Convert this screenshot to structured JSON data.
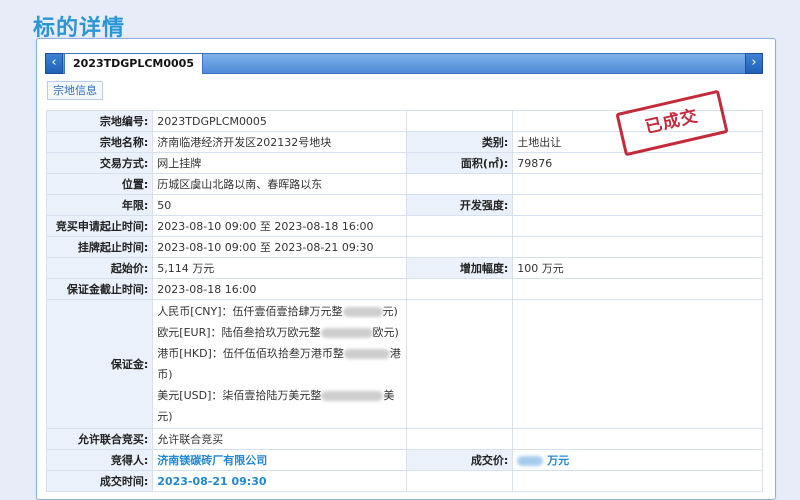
{
  "page": {
    "title": "标的详情"
  },
  "tabs": {
    "active_label": "2023TDGPLCM0005",
    "prev_icon": "‹",
    "next_icon": "›"
  },
  "subtab": {
    "label": "宗地信息"
  },
  "stamp": {
    "text": "已成交"
  },
  "fields": {
    "parcel_no": {
      "label": "宗地编号:",
      "value": "2023TDGPLCM0005"
    },
    "parcel_name": {
      "label": "宗地名称:",
      "value": "济南临港经济开发区202132号地块"
    },
    "category": {
      "label": "类别:",
      "value": "土地出让"
    },
    "trade_mode": {
      "label": "交易方式:",
      "value": "网上挂牌"
    },
    "area": {
      "label": "面积(㎡):",
      "value": "79876"
    },
    "location": {
      "label": "位置:",
      "value": "历城区虞山北路以南、春晖路以东"
    },
    "term": {
      "label": "年限:",
      "value": "50"
    },
    "intensity": {
      "label": "开发强度:",
      "value": ""
    },
    "apply_period": {
      "label": "竞买申请起止时间:",
      "value": "2023-08-10 09:00 至 2023-08-18 16:00"
    },
    "listing_period": {
      "label": "挂牌起止时间:",
      "value": "2023-08-10 09:00 至 2023-08-21 09:30"
    },
    "start_price": {
      "label": "起始价:",
      "value": "5,114 万元"
    },
    "increment": {
      "label": "增加幅度:",
      "value": "100 万元"
    },
    "deposit_deadline": {
      "label": "保证金截止时间:",
      "value": "2023-08-18 16:00"
    },
    "deposit": {
      "label": "保证金:",
      "lines": {
        "cny_a": "人民币[CNY]：伍仟壹佰壹拾肆万元整",
        "cny_b": "元)",
        "eur_a": "欧元[EUR]：陆佰叁拾玖万欧元整",
        "eur_b": "欧元)",
        "hkd_a": "港币[HKD]：伍仟伍佰玖拾叁万港币整",
        "hkd_b": "港",
        "hkd_c": "币)",
        "usd_a": "美元[USD]：柒佰壹拾陆万美元整",
        "usd_b": "美元)"
      }
    },
    "joint_bid": {
      "label": "允许联合竞买:",
      "value": "允许联合竞买"
    },
    "winner": {
      "label": "竞得人:",
      "value": "济南镁碳砖厂有限公司"
    },
    "deal_price": {
      "label": "成交价:",
      "value": "万元"
    },
    "deal_time": {
      "label": "成交时间:",
      "value": "2023-08-21 09:30"
    }
  }
}
